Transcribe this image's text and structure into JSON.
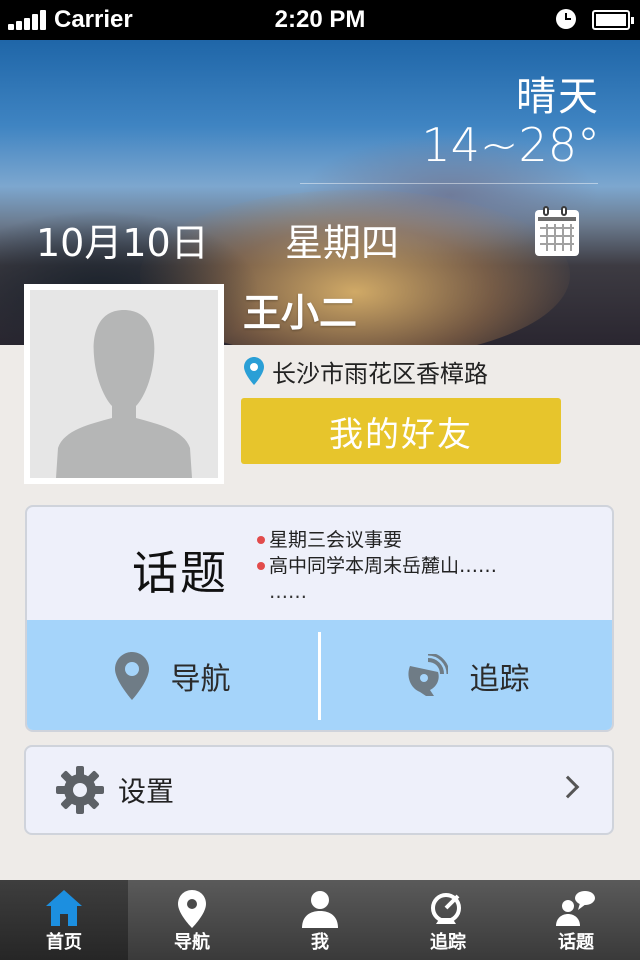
{
  "status_bar": {
    "carrier": "Carrier",
    "time": "2:20 PM"
  },
  "weather": {
    "condition": "晴天",
    "temperature": "14~28°"
  },
  "date": {
    "date": "10月10日",
    "weekday": "星期四"
  },
  "profile": {
    "name": "王小二",
    "location": "长沙市雨花区香樟路",
    "friends_button": "我的好友"
  },
  "topics": {
    "title": "话题",
    "items": [
      "星期三会议事要",
      "高中同学本周末岳麓山……"
    ],
    "more": "……"
  },
  "actions": {
    "navigation": "导航",
    "tracking": "追踪"
  },
  "settings": {
    "label": "设置"
  },
  "tabbar": {
    "active": "首页",
    "items": [
      "首页",
      "导航",
      "我",
      "追踪",
      "话题"
    ]
  },
  "colors": {
    "accent_yellow": "#e7c52c",
    "action_blue": "#a5d4fa",
    "location_pin": "#2a9fd6",
    "active_tab_icon": "#1c8fe0"
  }
}
